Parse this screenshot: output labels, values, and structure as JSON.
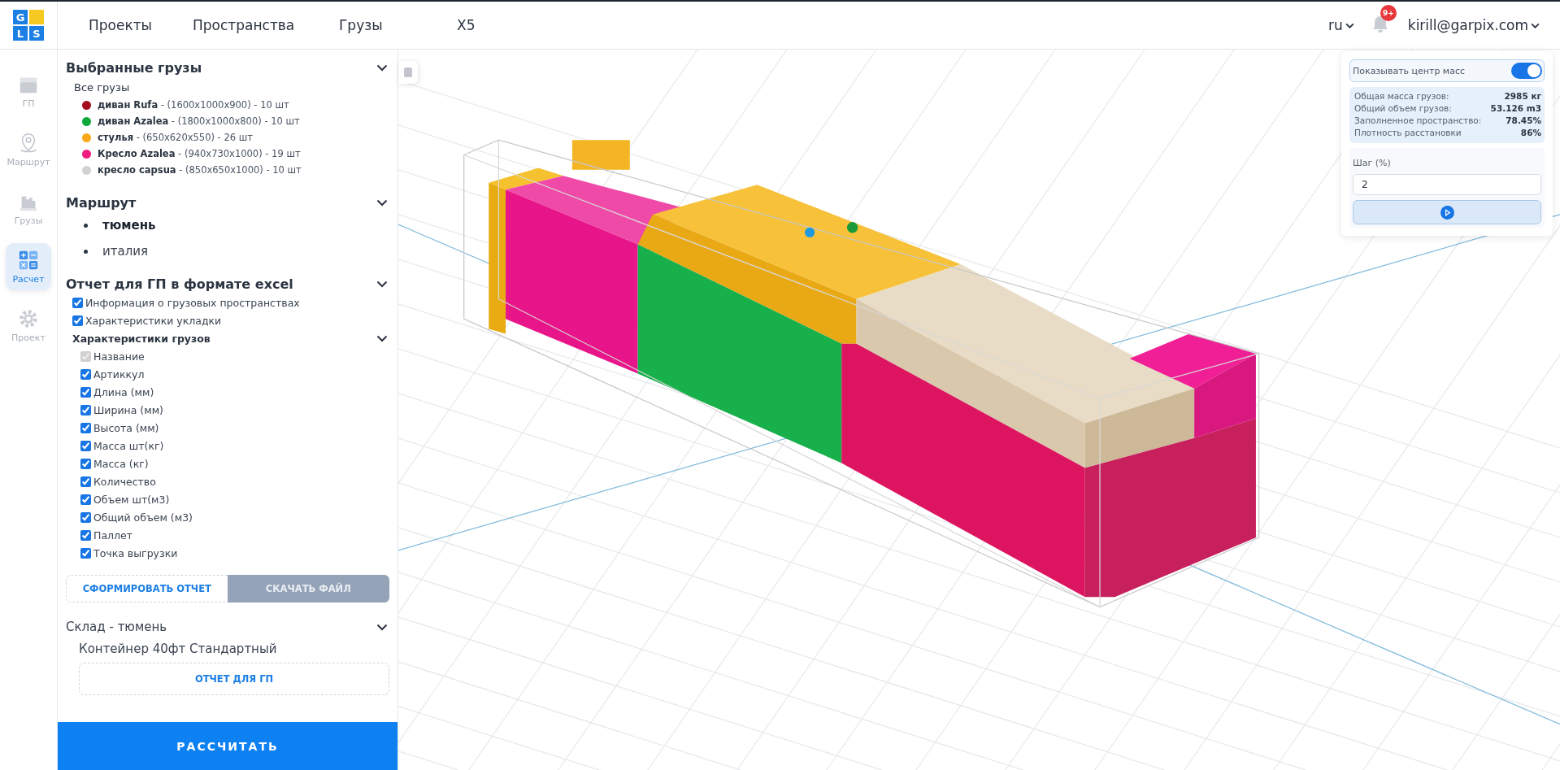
{
  "logo": {
    "letters": [
      "G",
      "L",
      "S"
    ]
  },
  "nav": [
    {
      "label": "Проекты"
    },
    {
      "label": "Пространства"
    },
    {
      "label": "Грузы"
    },
    {
      "label": "X5"
    }
  ],
  "header": {
    "language": "ru",
    "notification_badge": "9+",
    "user": "kirill@garpix.com"
  },
  "rail": [
    {
      "label": "ГП",
      "selected": false
    },
    {
      "label": "Маршрут",
      "selected": false
    },
    {
      "label": "Грузы",
      "selected": false
    },
    {
      "label": "Расчет",
      "selected": true
    },
    {
      "label": "Проект",
      "selected": false
    }
  ],
  "selected_cargo": {
    "title": "Выбранные грузы",
    "subtitle": "Все грузы",
    "items": [
      {
        "name": "диван Rufa",
        "details": " - (1600x1000x900) - 10 шт",
        "color": "#a50e1f"
      },
      {
        "name": "диван Azalea",
        "details": " - (1800x1000x800) - 10 шт",
        "color": "#0fa83a"
      },
      {
        "name": "стулья",
        "details": " - (650x620x550) - 26 шт",
        "color": "#f9a91a"
      },
      {
        "name": "Кресло Azalea",
        "details": " - (940x730x1000) - 19 шт",
        "color": "#ef1b7e"
      },
      {
        "name": "кресло capsua",
        "details": " - (850x650x1000) - 10 шт",
        "color": "#d2d2d2"
      }
    ]
  },
  "route": {
    "title": "Маршрут",
    "stops": [
      {
        "name": "тюмень",
        "current": true
      },
      {
        "name": "италия",
        "current": false
      }
    ]
  },
  "report": {
    "title": "Отчет для ГП в формате excel",
    "options": [
      {
        "label": "Информация о грузовых пространствах",
        "checked": true
      },
      {
        "label": "Характеристики укладки",
        "checked": true
      }
    ],
    "cargo_fields_title": "Характеристики грузов",
    "cargo_fields": [
      {
        "label": "Название",
        "checked": true,
        "disabled": true
      },
      {
        "label": "Артиккул",
        "checked": true,
        "disabled": false
      },
      {
        "label": "Длина (мм)",
        "checked": true,
        "disabled": false
      },
      {
        "label": "Ширина (мм)",
        "checked": true,
        "disabled": false
      },
      {
        "label": "Высота (мм)",
        "checked": true,
        "disabled": false
      },
      {
        "label": "Масса шт(кг)",
        "checked": true,
        "disabled": false
      },
      {
        "label": "Масса (кг)",
        "checked": true,
        "disabled": false
      },
      {
        "label": "Количество",
        "checked": true,
        "disabled": false
      },
      {
        "label": "Объем шт(м3)",
        "checked": true,
        "disabled": false
      },
      {
        "label": "Общий объем (м3)",
        "checked": true,
        "disabled": false
      },
      {
        "label": "Паллет",
        "checked": true,
        "disabled": false
      },
      {
        "label": "Точка выгрузки",
        "checked": true,
        "disabled": false
      }
    ],
    "generate_button": "СФОРМИРОВАТЬ ОТЧЕТ",
    "download_button": {
      "label": "СКАЧАТЬ ФАЙЛ",
      "disabled": true
    }
  },
  "warehouse": {
    "title": "Склад - тюмень",
    "container": "Контейнер 40фт Стандартный",
    "report_button": "ОТЧЕТ ДЛЯ ГП"
  },
  "calculate_button": "РАССЧИТАТЬ",
  "mass_panel": {
    "toggle_label": "Показывать центр масс",
    "toggle_on": true,
    "stats": [
      {
        "label": "Общая масса грузов:",
        "value": "2985 кг"
      },
      {
        "label": "Общий объем грузов:",
        "value": "53.126 m3"
      },
      {
        "label": "Заполненное пространство:",
        "value": "78.45%"
      },
      {
        "label": "Плотность расстановки",
        "value": "86%"
      }
    ],
    "step_label": "Шаг (%)",
    "step_value": "2"
  }
}
